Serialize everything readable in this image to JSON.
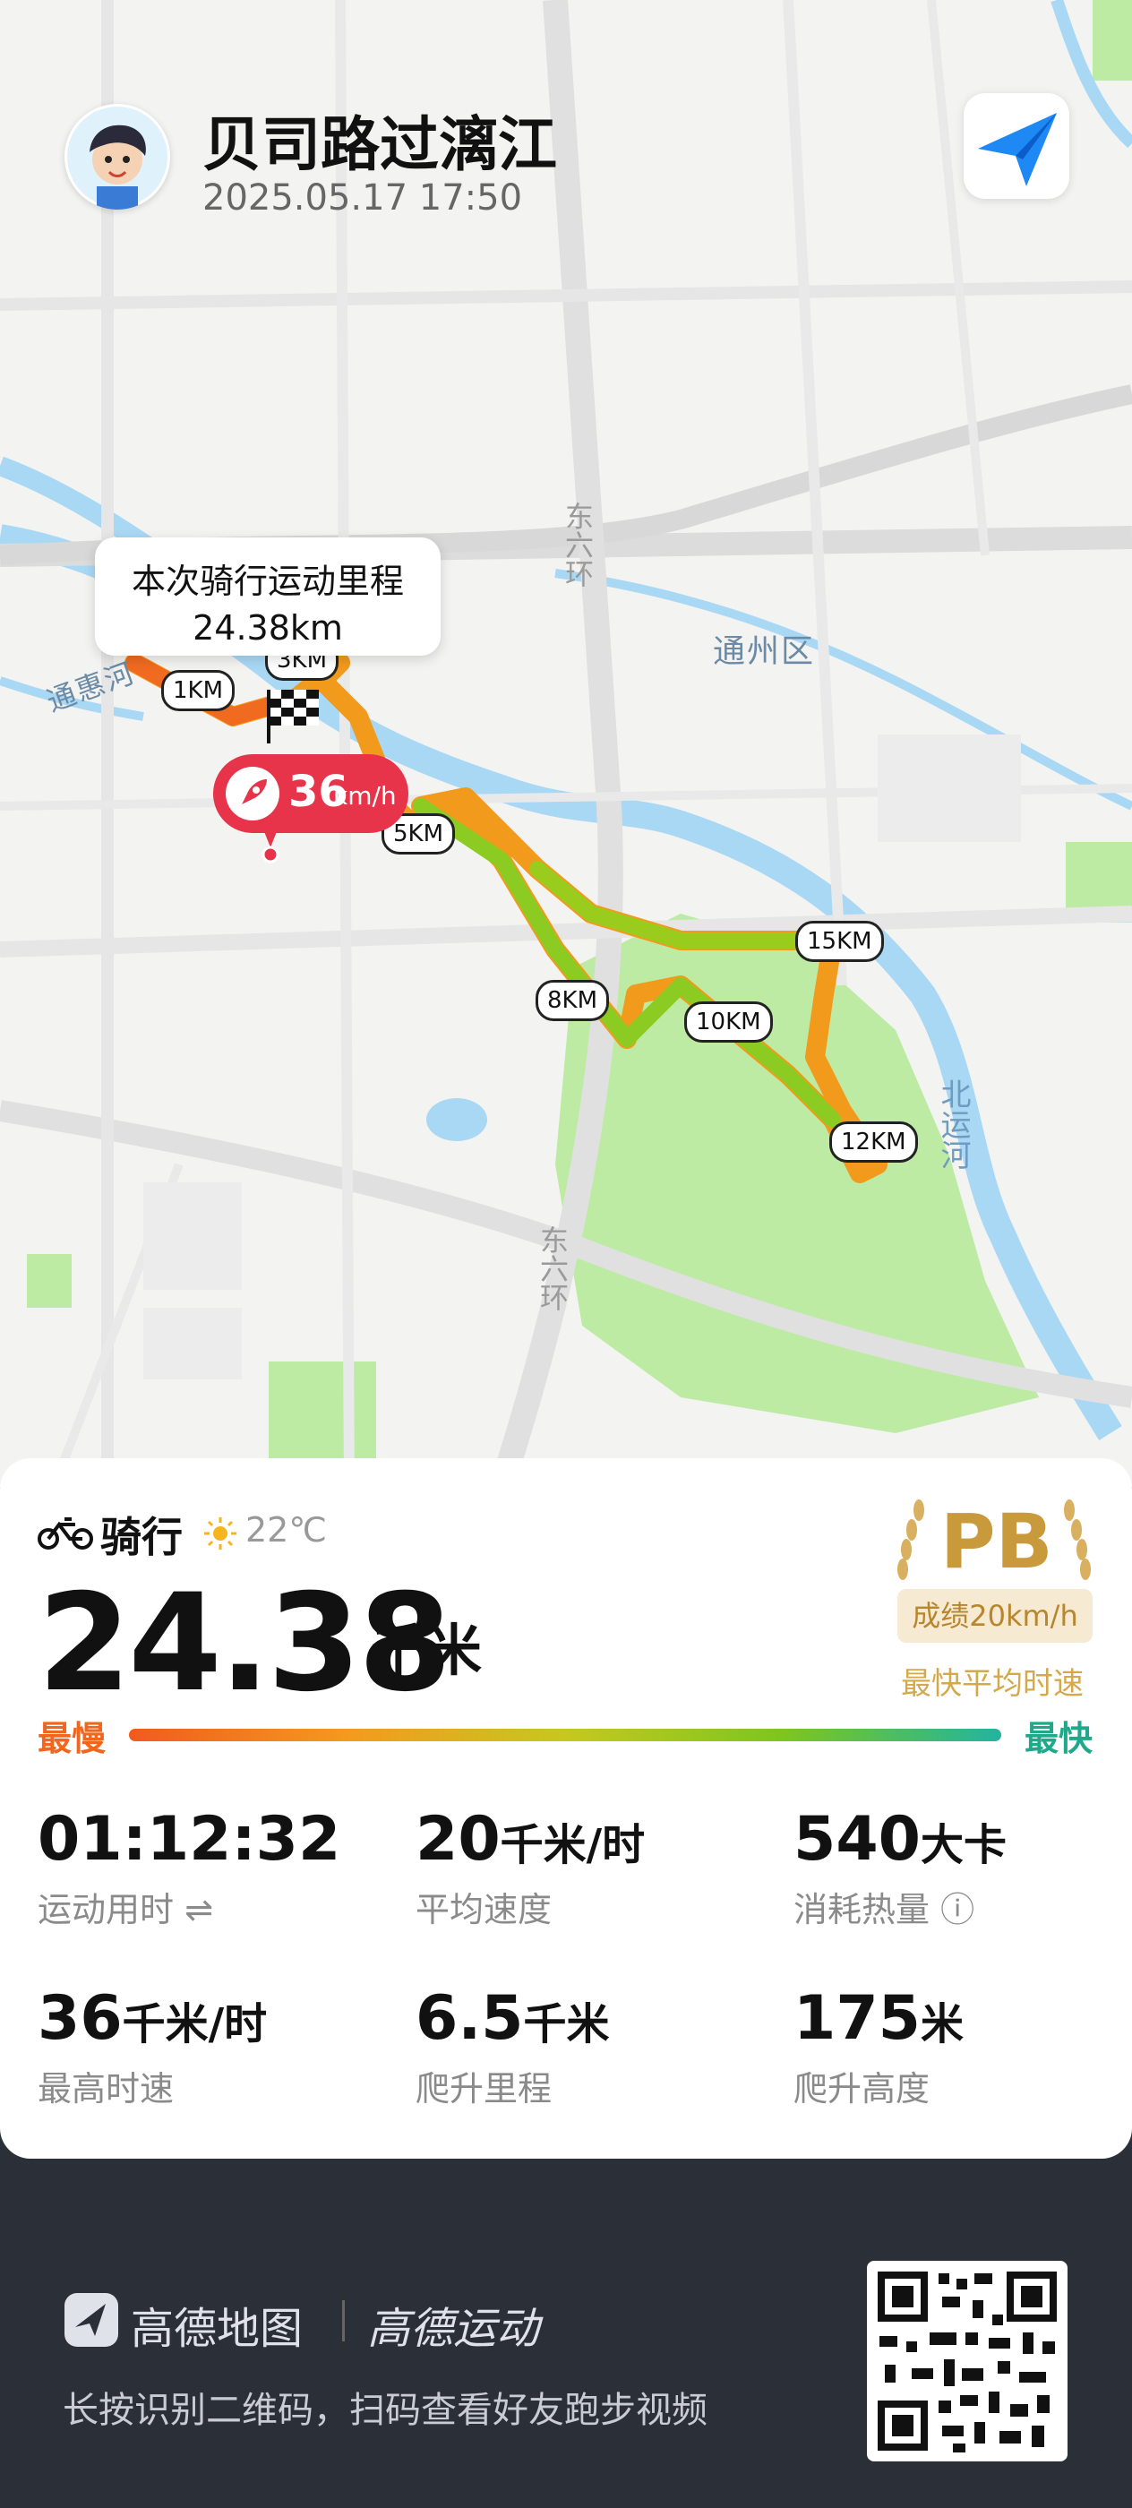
{
  "header": {
    "title": "贝司路过漓江",
    "datetime": "2025.05.17 17:50",
    "avatar_icon": "user-avatar-icon",
    "nav_icon": "paper-plane-icon"
  },
  "map": {
    "area_label": "通州区",
    "road_label_1": "东六环",
    "road_label_2": "东六环",
    "river_label_west": "通惠河",
    "river_label_east": "北运河",
    "distance_bubble": {
      "title": "本次骑行运动里程",
      "value": "24.38km"
    },
    "speed_pin": {
      "value": "36",
      "unit": "km/h",
      "icon": "rocket-icon"
    },
    "km_markers": [
      "1KM",
      "3KM",
      "5KM",
      "8KM",
      "10KM",
      "12KM",
      "15KM"
    ]
  },
  "card": {
    "sport_icon": "bicycle-icon",
    "sport_name": "骑行",
    "weather_icon": "sun-icon",
    "temperature": "22℃",
    "distance_value": "24.38",
    "distance_unit": "千米",
    "pb": {
      "label": "PB",
      "badge": "成绩20km/h",
      "caption": "最快平均时速"
    },
    "speed_legend": {
      "slow": "最慢",
      "fast": "最快"
    },
    "stats": [
      {
        "value": "01:12:32",
        "unit": "",
        "label": "运动用时 ⇌"
      },
      {
        "value": "20",
        "unit": "千米/时",
        "label": "平均速度"
      },
      {
        "value": "540",
        "unit": "大卡",
        "label": "消耗热量 ⓘ"
      },
      {
        "value": "36",
        "unit": "千米/时",
        "label": "最高时速"
      },
      {
        "value": "6.5",
        "unit": "千米",
        "label": "爬升里程"
      },
      {
        "value": "175",
        "unit": "米",
        "label": "爬升高度"
      }
    ]
  },
  "footer": {
    "brand_amap": "高德地图",
    "brand_sport": "高德运动",
    "tip": "长按识别二维码，扫码查看好友跑步视频",
    "qr_icon": "qr-code-icon"
  },
  "colors": {
    "slow": "#f0661f",
    "fast": "#1fa98a",
    "pb_gold": "#c99a3c",
    "pin_red": "#e8344a"
  }
}
